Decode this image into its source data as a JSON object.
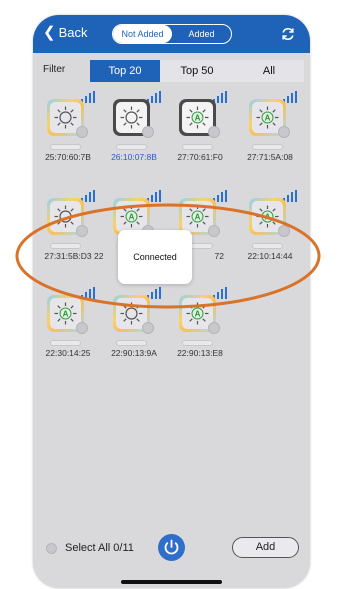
{
  "header": {
    "back_label": "Back",
    "segments": [
      {
        "label": "Not Added",
        "active": true
      },
      {
        "label": "Added",
        "active": false
      }
    ],
    "refresh_icon": "refresh-icon"
  },
  "filter": {
    "label": "Filter",
    "tabs": [
      {
        "label": "Top 20",
        "active": true
      },
      {
        "label": "Top 50",
        "active": false
      },
      {
        "label": "All",
        "active": false
      }
    ]
  },
  "devices": [
    {
      "label": "25:70:60:7B",
      "style": "rainbow",
      "glyph": "sun",
      "selected": false
    },
    {
      "label": "26:10:07:8B",
      "style": "gray",
      "glyph": "sun",
      "selected": true
    },
    {
      "label": "27:70:61:F0",
      "style": "gray",
      "glyph": "sun-a",
      "selected": false
    },
    {
      "label": "27:71:5A:08",
      "style": "rainbow",
      "glyph": "sun-a",
      "selected": false
    },
    {
      "label": "27:31:5B:D3",
      "style": "rainbow",
      "glyph": "sun",
      "selected": false
    },
    {
      "label": "22",
      "style": "rainbow",
      "glyph": "sun-a",
      "selected": false
    },
    {
      "label": "72",
      "style": "rainbow",
      "glyph": "sun-a",
      "selected": false
    },
    {
      "label": "22:10:14:44",
      "style": "rainbow",
      "glyph": "sun-a",
      "selected": false
    },
    {
      "label": "22:30:14:25",
      "style": "rainbow",
      "glyph": "sun-a",
      "selected": false
    },
    {
      "label": "22:90:13:9A",
      "style": "rainbow",
      "glyph": "sun",
      "selected": false
    },
    {
      "label": "22:90:13:E8",
      "style": "rainbow",
      "glyph": "sun-a",
      "selected": false
    }
  ],
  "toast": {
    "text": "Connected"
  },
  "footer": {
    "select_all_label": "Select All 0/11",
    "add_label": "Add",
    "power_icon": "power-icon"
  },
  "colors": {
    "brand_blue": "#1e63b8",
    "annotation_orange": "#d9732a",
    "screen_bg": "#d9d9dc"
  }
}
